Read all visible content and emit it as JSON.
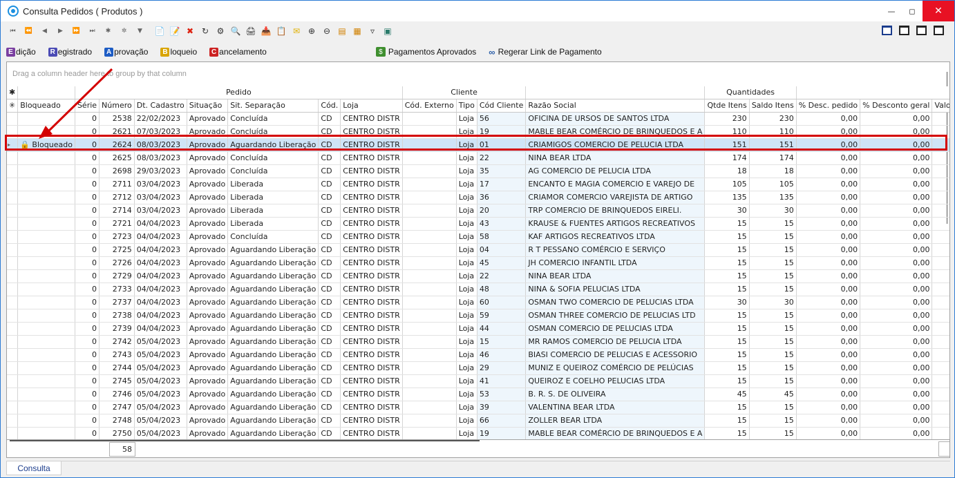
{
  "window": {
    "title": "Consulta Pedidos ( Produtos )"
  },
  "toolbar_icons": [
    "first-icon",
    "prev-page-icon",
    "prev-icon",
    "next-icon",
    "next-page-icon",
    "last-icon",
    "insert-icon",
    "delete-record-icon",
    "post-icon",
    "new-doc-icon",
    "edit-doc-icon",
    "cancel-icon",
    "refresh-icon",
    "config-icon",
    "preview-icon",
    "print-icon",
    "export-icon",
    "copy-icon",
    "email-icon",
    "zoom-in-icon",
    "zoom-out-icon",
    "layout-icon",
    "grid-icon",
    "filter-icon",
    "report-icon"
  ],
  "actions": [
    {
      "letter": "E",
      "rest": "dição",
      "color": "#7a3fa0"
    },
    {
      "letter": "R",
      "rest": "egistrado",
      "color": "#4b4bb5"
    },
    {
      "letter": "A",
      "rest": "provação",
      "color": "#1d5cc4"
    },
    {
      "letter": "B",
      "rest": "loqueio",
      "color": "#d9a400"
    },
    {
      "letter": "C",
      "rest": "ancelamento",
      "color": "#cc2222"
    }
  ],
  "extra_actions": {
    "pagamentos": "Pagamentos Aprovados",
    "regerar": "Regerar Link de Pagamento"
  },
  "grid": {
    "group_hint": "Drag a column header here to group by that column",
    "bands": {
      "pedido": "Pedido",
      "cliente": "Cliente",
      "quantidades": "Quantidades"
    },
    "columns": [
      "Bloqueado",
      "Série",
      "Número",
      "Dt. Cadastro",
      "Situação",
      "Sit. Separação",
      "Cód.",
      "Loja",
      "Cód. Externo",
      "Tipo",
      "Cód Cliente",
      "Razão Social",
      "Qtde Itens",
      "Saldo Itens",
      "% Desc. pedido",
      "% Desconto geral",
      "Valo"
    ],
    "rows": [
      [
        "",
        "0",
        "2538",
        "22/02/2023",
        "Aprovado",
        "Concluída",
        "CD",
        "CENTRO DISTR",
        "",
        "Loja",
        "56",
        "OFICINA DE URSOS DE SANTOS LTDA",
        "230",
        "230",
        "0,00",
        "0,00"
      ],
      [
        "",
        "0",
        "2621",
        "07/03/2023",
        "Aprovado",
        "Concluída",
        "CD",
        "CENTRO DISTR",
        "",
        "Loja",
        "19",
        "MABLE BEAR COMÉRCIO DE BRINQUEDOS E A",
        "110",
        "110",
        "0,00",
        "0,00"
      ],
      [
        "Bloqueado",
        "0",
        "2624",
        "08/03/2023",
        "Aprovado",
        "Aguardando Liberação",
        "CD",
        "CENTRO DISTR",
        "",
        "Loja",
        "01",
        "CRIAMIGOS COMERCIO DE PELUCIA LTDA",
        "151",
        "151",
        "0,00",
        "0,00"
      ],
      [
        "",
        "0",
        "2625",
        "08/03/2023",
        "Aprovado",
        "Concluída",
        "CD",
        "CENTRO DISTR",
        "",
        "Loja",
        "22",
        "NINA BEAR LTDA",
        "174",
        "174",
        "0,00",
        "0,00"
      ],
      [
        "",
        "0",
        "2698",
        "29/03/2023",
        "Aprovado",
        "Concluída",
        "CD",
        "CENTRO DISTR",
        "",
        "Loja",
        "35",
        "AG COMERCIO DE PELUCIA LTDA",
        "18",
        "18",
        "0,00",
        "0,00"
      ],
      [
        "",
        "0",
        "2711",
        "03/04/2023",
        "Aprovado",
        "Liberada",
        "CD",
        "CENTRO DISTR",
        "",
        "Loja",
        "17",
        "ENCANTO E MAGIA COMERCIO E VAREJO DE",
        "105",
        "105",
        "0,00",
        "0,00"
      ],
      [
        "",
        "0",
        "2712",
        "03/04/2023",
        "Aprovado",
        "Liberada",
        "CD",
        "CENTRO DISTR",
        "",
        "Loja",
        "36",
        "CRIAMOR COMERCIO VAREJISTA DE ARTIGO",
        "135",
        "135",
        "0,00",
        "0,00"
      ],
      [
        "",
        "0",
        "2714",
        "03/04/2023",
        "Aprovado",
        "Liberada",
        "CD",
        "CENTRO DISTR",
        "",
        "Loja",
        "20",
        "TRP COMERCIO DE BRINQUEDOS EIRELI.",
        "30",
        "30",
        "0,00",
        "0,00"
      ],
      [
        "",
        "0",
        "2721",
        "04/04/2023",
        "Aprovado",
        "Liberada",
        "CD",
        "CENTRO DISTR",
        "",
        "Loja",
        "43",
        "KRAUSE & FUENTES ARTIGOS RECREATIVOS",
        "15",
        "15",
        "0,00",
        "0,00"
      ],
      [
        "",
        "0",
        "2723",
        "04/04/2023",
        "Aprovado",
        "Concluída",
        "CD",
        "CENTRO DISTR",
        "",
        "Loja",
        "58",
        "KAF ARTIGOS RECREATIVOS LTDA",
        "15",
        "15",
        "0,00",
        "0,00"
      ],
      [
        "",
        "0",
        "2725",
        "04/04/2023",
        "Aprovado",
        "Aguardando Liberação",
        "CD",
        "CENTRO DISTR",
        "",
        "Loja",
        "04",
        "R T PESSANO COMÉRCIO E SERVIÇO",
        "15",
        "15",
        "0,00",
        "0,00"
      ],
      [
        "",
        "0",
        "2726",
        "04/04/2023",
        "Aprovado",
        "Aguardando Liberação",
        "CD",
        "CENTRO DISTR",
        "",
        "Loja",
        "45",
        "JH COMERCIO INFANTIL LTDA",
        "15",
        "15",
        "0,00",
        "0,00"
      ],
      [
        "",
        "0",
        "2729",
        "04/04/2023",
        "Aprovado",
        "Aguardando Liberação",
        "CD",
        "CENTRO DISTR",
        "",
        "Loja",
        "22",
        "NINA BEAR LTDA",
        "15",
        "15",
        "0,00",
        "0,00"
      ],
      [
        "",
        "0",
        "2733",
        "04/04/2023",
        "Aprovado",
        "Aguardando Liberação",
        "CD",
        "CENTRO DISTR",
        "",
        "Loja",
        "48",
        "NINA & SOFIA PELUCIAS LTDA",
        "15",
        "15",
        "0,00",
        "0,00"
      ],
      [
        "",
        "0",
        "2737",
        "04/04/2023",
        "Aprovado",
        "Aguardando Liberação",
        "CD",
        "CENTRO DISTR",
        "",
        "Loja",
        "60",
        "OSMAN TWO COMERCIO DE PELUCIAS LTDA",
        "30",
        "30",
        "0,00",
        "0,00"
      ],
      [
        "",
        "0",
        "2738",
        "04/04/2023",
        "Aprovado",
        "Aguardando Liberação",
        "CD",
        "CENTRO DISTR",
        "",
        "Loja",
        "59",
        "OSMAN THREE COMERCIO DE PELUCIAS LTD",
        "15",
        "15",
        "0,00",
        "0,00"
      ],
      [
        "",
        "0",
        "2739",
        "04/04/2023",
        "Aprovado",
        "Aguardando Liberação",
        "CD",
        "CENTRO DISTR",
        "",
        "Loja",
        "44",
        "OSMAN COMERCIO DE PELUCIAS LTDA",
        "15",
        "15",
        "0,00",
        "0,00"
      ],
      [
        "",
        "0",
        "2742",
        "05/04/2023",
        "Aprovado",
        "Aguardando Liberação",
        "CD",
        "CENTRO DISTR",
        "",
        "Loja",
        "15",
        "MR RAMOS COMERCIO DE PELUCIA LTDA",
        "15",
        "15",
        "0,00",
        "0,00"
      ],
      [
        "",
        "0",
        "2743",
        "05/04/2023",
        "Aprovado",
        "Aguardando Liberação",
        "CD",
        "CENTRO DISTR",
        "",
        "Loja",
        "46",
        "BIASI COMERCIO DE PELUCIAS E ACESSORIO",
        "15",
        "15",
        "0,00",
        "0,00"
      ],
      [
        "",
        "0",
        "2744",
        "05/04/2023",
        "Aprovado",
        "Aguardando Liberação",
        "CD",
        "CENTRO DISTR",
        "",
        "Loja",
        "29",
        "MUNIZ E QUEIROZ COMÉRCIO DE PELÚCIAS",
        "15",
        "15",
        "0,00",
        "0,00"
      ],
      [
        "",
        "0",
        "2745",
        "05/04/2023",
        "Aprovado",
        "Aguardando Liberação",
        "CD",
        "CENTRO DISTR",
        "",
        "Loja",
        "41",
        "QUEIROZ E COELHO PELUCIAS LTDA",
        "15",
        "15",
        "0,00",
        "0,00"
      ],
      [
        "",
        "0",
        "2746",
        "05/04/2023",
        "Aprovado",
        "Aguardando Liberação",
        "CD",
        "CENTRO DISTR",
        "",
        "Loja",
        "53",
        "B. R. S. DE OLIVEIRA",
        "45",
        "45",
        "0,00",
        "0,00"
      ],
      [
        "",
        "0",
        "2747",
        "05/04/2023",
        "Aprovado",
        "Aguardando Liberação",
        "CD",
        "CENTRO DISTR",
        "",
        "Loja",
        "39",
        "VALENTINA BEAR LTDA",
        "15",
        "15",
        "0,00",
        "0,00"
      ],
      [
        "",
        "0",
        "2748",
        "05/04/2023",
        "Aprovado",
        "Aguardando Liberação",
        "CD",
        "CENTRO DISTR",
        "",
        "Loja",
        "66",
        "ZOLLER BEAR LTDA",
        "15",
        "15",
        "0,00",
        "0,00"
      ],
      [
        "",
        "0",
        "2750",
        "05/04/2023",
        "Aprovado",
        "Aguardando Liberação",
        "CD",
        "CENTRO DISTR",
        "",
        "Loja",
        "19",
        "MABLE BEAR COMÉRCIO DE BRINQUEDOS E A",
        "15",
        "15",
        "0,00",
        "0,00"
      ]
    ],
    "selected_row": 2,
    "footer_count": "58"
  },
  "status_tabs": [
    "Consulta"
  ],
  "colors": {
    "highlight": "#d40000",
    "selection": "#cfe4f7",
    "accent": "#2b7bd4"
  }
}
